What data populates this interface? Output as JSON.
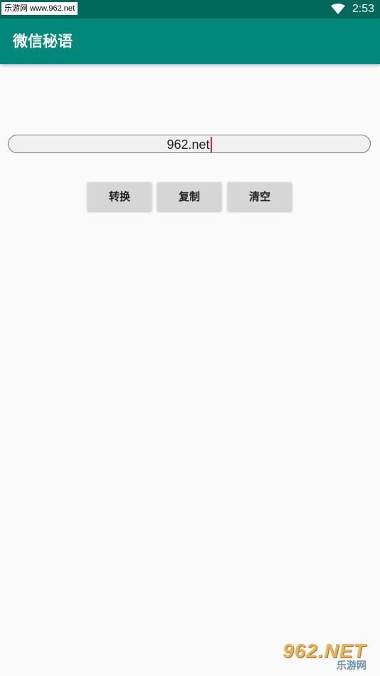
{
  "status_bar": {
    "watermark": "乐游网 www.962.net",
    "wifi_icon": "wifi-icon",
    "time": "2:53",
    "color": "#00695c"
  },
  "app_bar": {
    "title": "微信秘语",
    "color": "#00897b"
  },
  "input": {
    "value": "962.net",
    "caret_color": "#d81b60"
  },
  "buttons": {
    "convert": "转换",
    "copy": "复制",
    "clear": "清空"
  },
  "watermark_logo": {
    "main": "962.NET",
    "sub": "乐游网"
  }
}
